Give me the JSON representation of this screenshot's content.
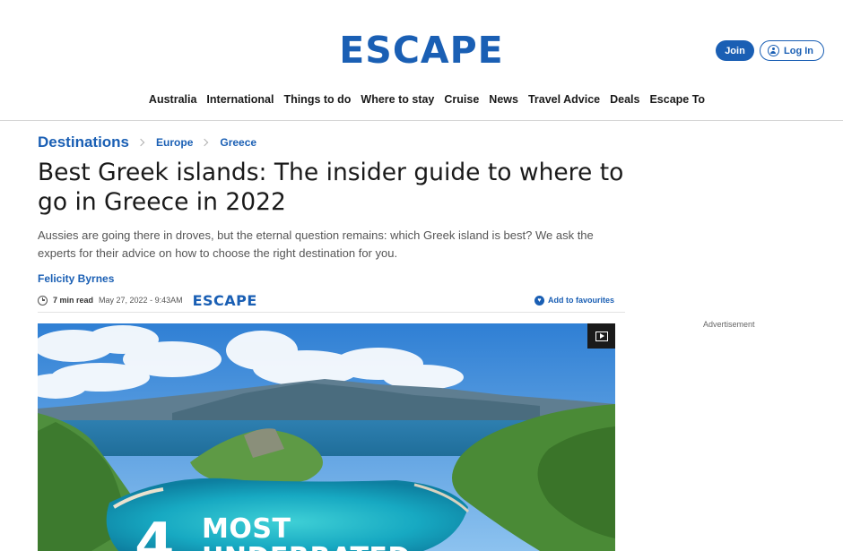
{
  "header": {
    "logo": "ESCAPE",
    "join_label": "Join",
    "login_label": "Log In",
    "login_icon": "user-icon"
  },
  "nav": {
    "items": [
      "Australia",
      "International",
      "Things to do",
      "Where to stay",
      "Cruise",
      "News",
      "Travel Advice",
      "Deals",
      "Escape To"
    ]
  },
  "breadcrumb": {
    "main": "Destinations",
    "items": [
      "Europe",
      "Greece"
    ]
  },
  "article": {
    "title": "Best Greek islands: The insider guide to where to go in Greece in 2022",
    "standfirst": "Aussies are going there in droves, but the eternal question remains: which Greek island is best? We ask the experts for their advice on how to choose the right destination for you.",
    "author": "Felicity Byrnes",
    "read_time": "7 min read",
    "date": "May 27, 2022 - 9:43AM",
    "source_logo": "ESCAPE",
    "favourite_label": "Add to favourites"
  },
  "sidebar": {
    "ad_label": "Advertisement"
  },
  "hero": {
    "overlay_number": "4",
    "overlay_text": "MOST\nUNDERRATED"
  },
  "colors": {
    "brand": "#1a5fb4",
    "text": "#1a1a1a",
    "muted": "#555555"
  }
}
